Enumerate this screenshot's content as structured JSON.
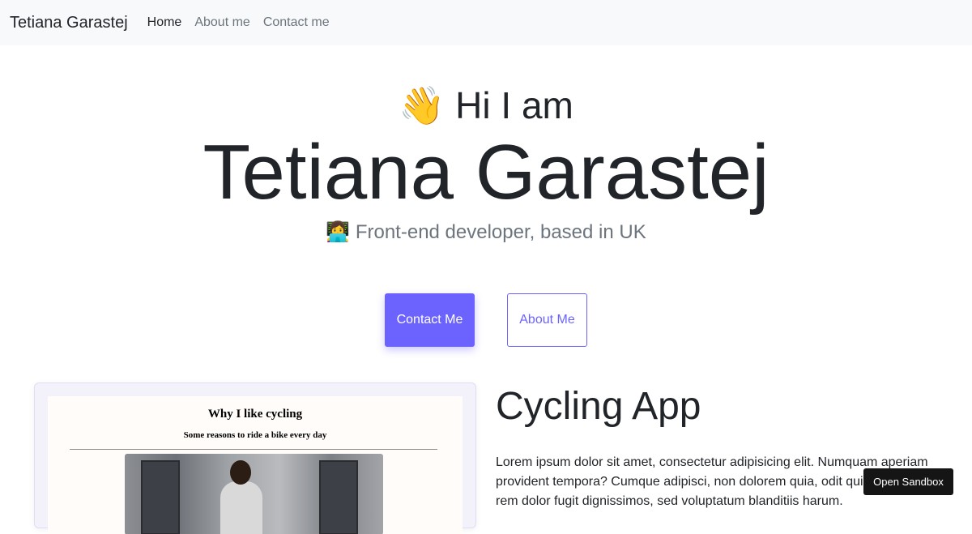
{
  "nav": {
    "brand": "Tetiana Garastej",
    "links": [
      "Home",
      "About me",
      "Contact me"
    ]
  },
  "hero": {
    "greeting": "👋 Hi I am",
    "name": "Tetiana Garastej",
    "subtitle": "👩‍💻 Front-end developer, based in UK"
  },
  "buttons": {
    "contact": "Contact Me",
    "about": "About Me"
  },
  "project": {
    "preview_title": "Why I like cycling",
    "preview_subtitle": "Some reasons to ride a bike every day",
    "title": "Cycling App",
    "description": "Lorem ipsum dolor sit amet, consectetur adipisicing elit. Numquam aperiam provident tempora? Cumque adipisci, non dolorem quia, odit qui a exceptui rem dolor fugit dignissimos, sed voluptatum blanditiis harum."
  },
  "sandbox": {
    "label": "Open Sandbox"
  },
  "colors": {
    "accent": "#6c63ff",
    "nav_bg": "#f8f9fa",
    "text": "#212529",
    "muted": "#6c757d"
  }
}
